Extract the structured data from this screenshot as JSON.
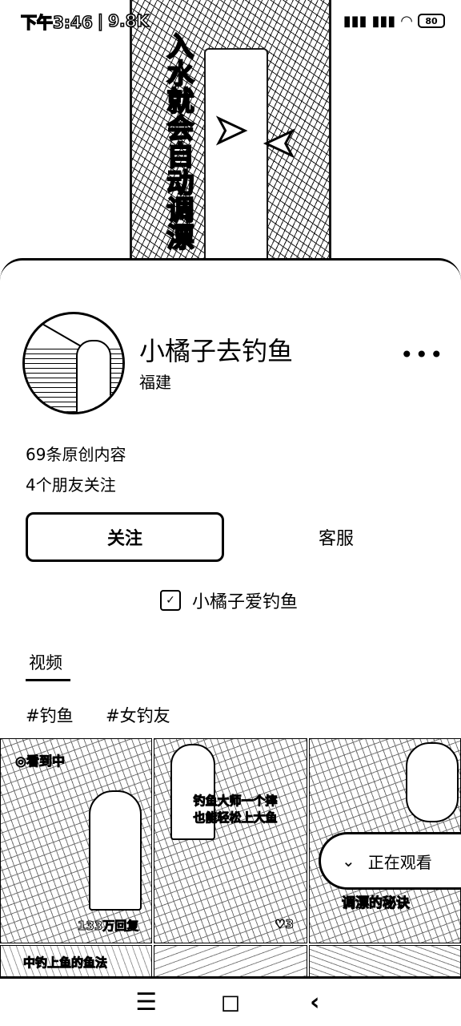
{
  "status_bar": {
    "time": "下午3:46",
    "net_speed": "9.8K",
    "battery": "80",
    "left_icons": [
      "location-icon",
      "hd-icon"
    ],
    "right_icons": [
      "signal-icon",
      "signal-icon",
      "wifi-icon",
      "battery-icon"
    ]
  },
  "video": {
    "caption": "入水就会自动调漂"
  },
  "profile": {
    "name": "小橘子去钓鱼",
    "location": "福建",
    "original_count": "69条原创内容",
    "friends_following": "4个朋友关注"
  },
  "actions": {
    "follow_label": "关注",
    "service_label": "客服"
  },
  "shop": {
    "label": "小橘子爱钓鱼"
  },
  "tabs": [
    {
      "label": "视频",
      "active": true
    }
  ],
  "hashtags": [
    "#钓鱼",
    "#女钓友"
  ],
  "grid": [
    {
      "badge": "◎看到中",
      "stat": "133万回复"
    },
    {
      "caption": "钓鱼大师一个摔\n也能轻松上大鱼",
      "stat": "♡3"
    },
    {
      "caption": "调漂的秘诀"
    }
  ],
  "grid_row2": [
    {
      "caption": "中钓上鱼的鱼法"
    }
  ],
  "watching": {
    "label": "正在观看"
  },
  "nav": {
    "menu": "☰",
    "home": "◻",
    "back": "‹"
  }
}
